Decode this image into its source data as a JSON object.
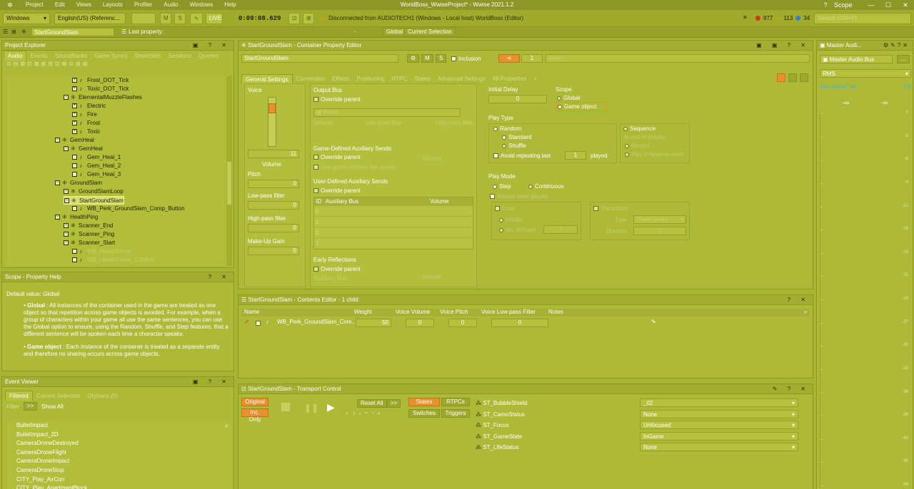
{
  "app": {
    "title": "WorldBoss_WwiseProject* - Wwise 2021.1.2",
    "scope_label": "Scope",
    "search_placeholder": "Search (Ctrl+F)"
  },
  "menu": [
    "Project",
    "Edit",
    "Views",
    "Layouts",
    "Profiler",
    "Audio",
    "Windows",
    "Help"
  ],
  "toolbar": {
    "layout": "Windows",
    "language": "English(US) (Referenc...",
    "m_btn": "M",
    "s_btn": "S",
    "live": "LIVE",
    "time": "0:09:08.629",
    "status": "Disconnected from AUDIOTECH1 (Windows - Local host) WorldBoss (Editor)",
    "count_errors": "977",
    "count_warnings": "113",
    "count_info": "34"
  },
  "ctx": {
    "object": "StartGroundSlam",
    "last_property": "Last property:",
    "dash": "-",
    "global": "Global",
    "current_selection": "Current Selection"
  },
  "explorer": {
    "title": "Project Explorer",
    "tabs": [
      "Audio",
      "Events",
      "SoundBanks",
      "Game Syncs",
      "ShareSets",
      "Sessions",
      "Queries"
    ],
    "items": [
      {
        "label": "Frost_DOT_Tick",
        "level": 3
      },
      {
        "label": "Toxic_DOT_Tick",
        "level": 3
      },
      {
        "label": "ElementalMuzzleFlashes",
        "level": 2
      },
      {
        "label": "Electric",
        "level": 3
      },
      {
        "label": "Fire",
        "level": 3
      },
      {
        "label": "Frost",
        "level": 3
      },
      {
        "label": "Toxic",
        "level": 3
      },
      {
        "label": "GemHeal",
        "level": 1
      },
      {
        "label": "GemHeal",
        "level": 2
      },
      {
        "label": "Gem_Heal_1",
        "level": 3
      },
      {
        "label": "Gem_Heal_2",
        "level": 3
      },
      {
        "label": "Gem_Heal_3",
        "level": 3
      },
      {
        "label": "GroundSlam",
        "level": 1
      },
      {
        "label": "GroundSlamLoop",
        "level": 2
      },
      {
        "label": "StartGroundSlam",
        "level": 2
      },
      {
        "label": "WB_Perk_GroundSlam_Comp_Button",
        "level": 3
      },
      {
        "label": "HealthPing",
        "level": 1
      },
      {
        "label": "Scanner_End",
        "level": 2
      },
      {
        "label": "Scanner_Ping",
        "level": 2
      },
      {
        "label": "Scanner_Start",
        "level": 2
      },
      {
        "label": "WB_HealthSonar",
        "level": 3
      },
      {
        "label": "WB_HealthSonar_Confirm",
        "level": 3
      }
    ]
  },
  "help": {
    "title": "Scope - Property Help",
    "default": "Default value: Global",
    "global_term": "Global",
    "global_text": ": All instances of the container used in the game are treated as one object so that repetition across game objects is avoided. For example, when a group of characters within your game all use the same sentences, you can use the Global option to ensure, using the Random, Shuffle, and Step features, that a different sentence will be spoken each time a character speaks.",
    "go_term": "Game object",
    "go_text": ": Each instance of the container is treated as a separate entity and therefore no sharing occurs across game objects."
  },
  "events": {
    "title": "Event Viewer",
    "tabs": [
      "Filtered",
      "Current Selection",
      "Orphans (5)"
    ],
    "filter": "Filter",
    "filter_btn": ">>",
    "show_all": "Show All",
    "items": [
      "BulletImpact",
      "BulletImpact_2D",
      "CameraDroneDestroyed",
      "CameraDroneFlight",
      "CameraDroneImpact",
      "CameraDroneStop",
      "CITY_Play_AirCon",
      "CITY_Play_ApartmentBlock"
    ]
  },
  "editor": {
    "title": "StartGroundSlam - Container Property Editor",
    "name": "StartGroundSlam",
    "inclusion": "Inclusion",
    "count": "1",
    "notes": "Notes",
    "tabs": [
      "General Settings",
      "Conversion",
      "Effects",
      "Positioning",
      "RTPC",
      "States",
      "Advanced Settings",
      "All Properties",
      "+"
    ],
    "voice": "Voice",
    "volume_value": "11",
    "volume": "Volume",
    "pitch": "Pitch",
    "pitch_value": "0",
    "lpf": "Low-pass filter",
    "lpf_value": "0",
    "hpf": "High-pass filter",
    "hpf_value": "0",
    "makeup": "Make-Up Gain",
    "makeup_value": "0",
    "output_bus": "Output Bus",
    "override_parent": "Override parent",
    "bus_name": "Perks",
    "bus_cols": [
      "Volume",
      "Low-pass filter",
      "High-pass filter"
    ],
    "gd_aux": "Game-Defined Auxiliary Sends",
    "use_gd": "Use game-defined aux sends",
    "gd_volume": "Volume",
    "ud_aux": "User-Defined Auxiliary Sends",
    "aux_cols": [
      "ID",
      "Auxiliary Bus",
      "Volume"
    ],
    "aux_rows": [
      "0",
      "1",
      "2",
      "3"
    ],
    "early": "Early Reflections",
    "aux_bus": "Auxiliary Bus",
    "er_volume": "Volume",
    "initial_delay": "Initial Delay",
    "initial_delay_value": "0",
    "scope": "Scope",
    "scope_global": "Global",
    "scope_go": "Game object",
    "play_type": "Play Type",
    "random": "Random",
    "standard": "Standard",
    "shuffle": "Shuffle",
    "avoid": "Avoid repeating last",
    "avoid_value": "1",
    "played": "played",
    "sequence": "Sequence",
    "at_end": "At end of playlist",
    "restart": "Restart",
    "play_reverse": "Play in reverse order",
    "play_mode": "Play Mode",
    "step": "Step",
    "continuous": "Continuous",
    "always_reset": "Always reset playlist",
    "loop": "Loop",
    "transitions": "Transitions",
    "infinite": "Infinite",
    "no_loops": "No. of loops",
    "no_loops_value": "2",
    "type": "Type",
    "type_value": "Xfade (amp)",
    "duration": "Duration",
    "duration_value": "1"
  },
  "contents": {
    "title": "StartGroundSlam - Contents Editor - 1 child",
    "cols": [
      "Name",
      "Weight",
      "Voice Volume",
      "Voice Pitch",
      "Voice Low-pass Filter",
      "Notes"
    ],
    "row": {
      "name": "WB_Perk_GroundSlam_Com...",
      "weight": "50",
      "vv": "0",
      "vp": "0",
      "vlpf": "0"
    }
  },
  "transport": {
    "title": "StartGroundSlam - Transport Control",
    "original": "Original",
    "inc_only": "Inc. Only",
    "reset_all": "Reset All",
    "reset_more": ">>",
    "states": "States",
    "rtpcs": "RTPCs",
    "switches": "Switches",
    "triggers": "Triggers",
    "states_list": [
      {
        "name": "ST_BubbleShield",
        "value": "_02"
      },
      {
        "name": "ST_CamoStatus",
        "value": "None"
      },
      {
        "name": "ST_Focus",
        "value": "Unfocused"
      },
      {
        "name": "ST_GameState",
        "value": "InGame"
      },
      {
        "name": "ST_LifeStatus",
        "value": "None"
      }
    ]
  },
  "meter": {
    "title": "Master Audi...",
    "bus": "Master Audio Bus",
    "mode": "RMS",
    "label": "Bus output: all",
    "value": "0.0",
    "left": "-∞",
    "right": "-∞",
    "ticks": [
      "0",
      "-3",
      "-6",
      "-9",
      "-12",
      "-15",
      "-18",
      "-21",
      "-24",
      "-27",
      "-30",
      "-33",
      "-36",
      "-39",
      "-42",
      "-45",
      "-48"
    ]
  },
  "colors": {
    "accent": "#e6912e",
    "bg": "#a9b432"
  }
}
